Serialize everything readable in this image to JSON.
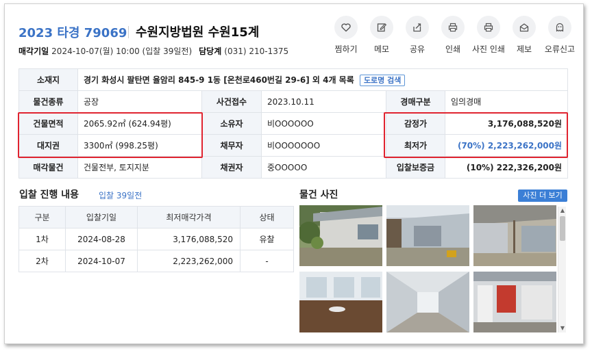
{
  "header": {
    "case_number": "2023 타경 79069",
    "court": "수원지방법원 수원15계",
    "sale_date_label": "매각기일",
    "sale_date_value": "2024-10-07(월) 10:00 (입찰 39일전)",
    "dept_label": "담당계",
    "dept_phone": "(031) 210-1375"
  },
  "actions": [
    {
      "label": "찜하기",
      "icon": "heart-icon"
    },
    {
      "label": "메모",
      "icon": "memo-icon"
    },
    {
      "label": "공유",
      "icon": "share-icon"
    },
    {
      "label": "인쇄",
      "icon": "print-icon"
    },
    {
      "label": "사진 인쇄",
      "icon": "photo-print-icon"
    },
    {
      "label": "제보",
      "icon": "report-icon"
    },
    {
      "label": "오류신고",
      "icon": "error-report-icon"
    }
  ],
  "info": {
    "location_label": "소재지",
    "location_value": "경기 화성시 팔탄면 율암리 845-9 1동 [온천로460번길 29-6] 외 4개 목록",
    "road_search": "도로명 검색",
    "type_label": "물건종류",
    "type_value": "공장",
    "receipt_label": "사건접수",
    "receipt_value": "2023.10.11",
    "sale_kind_label": "경매구분",
    "sale_kind_value": "임의경매",
    "bldg_area_label": "건물면적",
    "bldg_area_value": "2065.92㎡ (624.94평)",
    "owner_label": "소유자",
    "owner_value": "비OOOOOO",
    "appraisal_label": "감정가",
    "appraisal_value": "3,176,088,520원",
    "land_label": "대지권",
    "land_value": "3300㎡ (998.25평)",
    "debtor_label": "채무자",
    "debtor_value": "비OOOOOOO",
    "min_price_label": "최저가",
    "min_price_value": "(70%) 2,223,262,000원",
    "item_label": "매각물건",
    "item_value": "건물전부, 토지지분",
    "creditor_label": "채권자",
    "creditor_value": "중OOOOO",
    "deposit_label": "입찰보증금",
    "deposit_value": "(10%) 222,326,200원"
  },
  "bidding": {
    "title": "입찰 진행 내용",
    "days_left": "입찰 39일전",
    "headers": [
      "구분",
      "입찰기일",
      "최저매각가격",
      "상태"
    ],
    "rows": [
      [
        "1차",
        "2024-08-28",
        "3,176,088,520",
        "유찰"
      ],
      [
        "2차",
        "2024-10-07",
        "2,223,262,000",
        "-"
      ]
    ]
  },
  "photos": {
    "title": "물건 사진",
    "more_button": "사진 더 보기"
  },
  "colors": {
    "accent": "#3b73c6",
    "highlight_box": "#e0232f",
    "header_cell_bg": "#f2f5f9"
  }
}
